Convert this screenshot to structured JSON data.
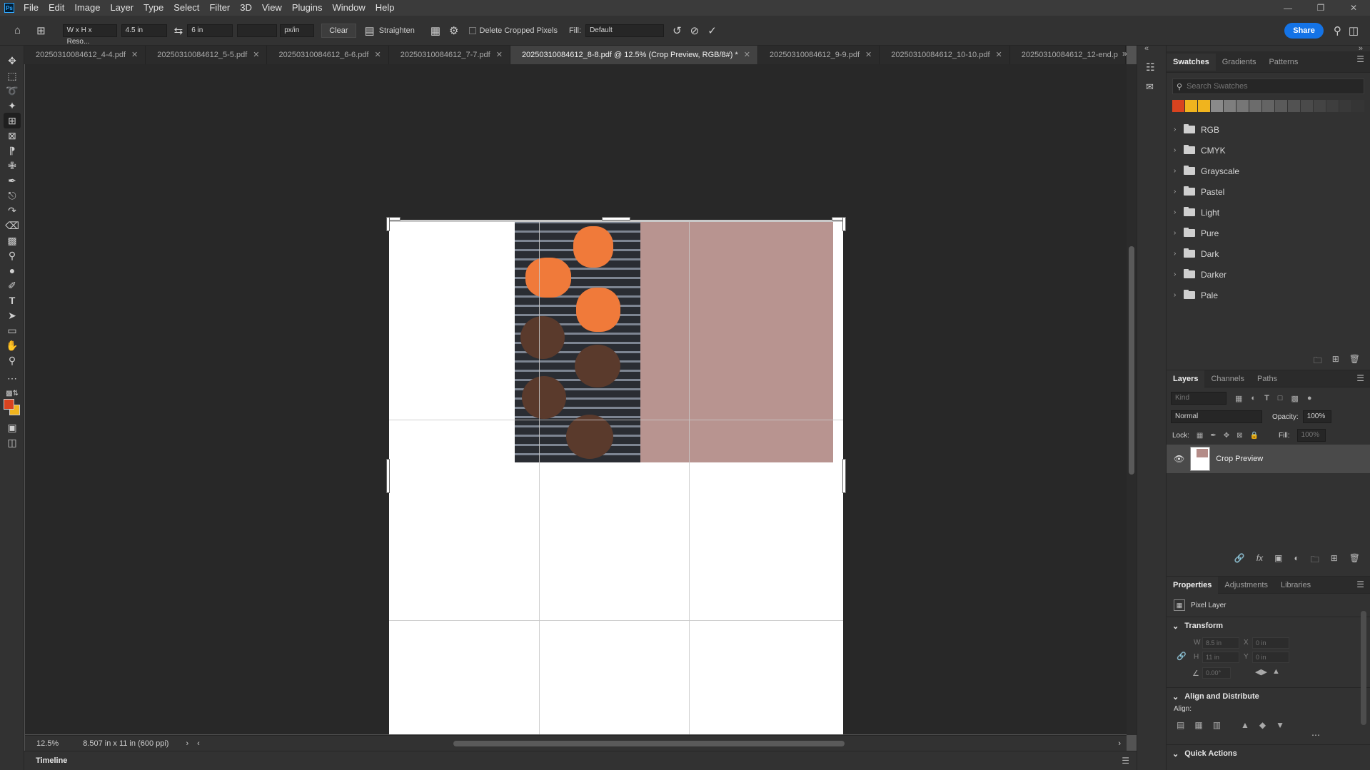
{
  "menubar": {
    "logo": "Ps",
    "items": [
      "File",
      "Edit",
      "Image",
      "Layer",
      "Type",
      "Select",
      "Filter",
      "3D",
      "View",
      "Plugins",
      "Window",
      "Help"
    ]
  },
  "options": {
    "ratio_preset": "W x H x Reso...",
    "width": "4.5 in",
    "height": "6 in",
    "resolution": "",
    "res_unit": "px/in",
    "clear": "Clear",
    "straighten": "Straighten",
    "delete_cropped": "Delete Cropped Pixels",
    "fill_label": "Fill:",
    "fill_value": "Default",
    "share": "Share"
  },
  "tabs": [
    {
      "label": "20250310084612_4-4.pdf",
      "active": false
    },
    {
      "label": "20250310084612_5-5.pdf",
      "active": false
    },
    {
      "label": "20250310084612_6-6.pdf",
      "active": false
    },
    {
      "label": "20250310084612_7-7.pdf",
      "active": false
    },
    {
      "label": "20250310084612_8-8.pdf @ 12.5% (Crop Preview, RGB/8#) *",
      "active": true
    },
    {
      "label": "20250310084612_9-9.pdf",
      "active": false
    },
    {
      "label": "20250310084612_10-10.pdf",
      "active": false
    },
    {
      "label": "20250310084612_12-end.p",
      "active": false
    }
  ],
  "status": {
    "zoom": "12.5%",
    "doc_info": "8.507 in x 11 in (600 ppi)"
  },
  "timeline": "Timeline",
  "swatches": {
    "tabs": [
      "Swatches",
      "Gradients",
      "Patterns"
    ],
    "search_placeholder": "Search Swatches",
    "recent_colors": [
      "#d9431f",
      "#f0b41e",
      "#f0b41e",
      "#8a8a8a",
      "#7e7e7e",
      "#767676",
      "#6c6c6c",
      "#646464",
      "#5a5a5a",
      "#525252",
      "#4a4a4a",
      "#444444",
      "#3e3e3e",
      "#393939",
      "#353535"
    ],
    "groups": [
      "RGB",
      "CMYK",
      "Grayscale",
      "Pastel",
      "Light",
      "Pure",
      "Dark",
      "Darker",
      "Pale"
    ]
  },
  "layers": {
    "tabs": [
      "Layers",
      "Channels",
      "Paths"
    ],
    "kind_placeholder": "Kind",
    "blend_mode": "Normal",
    "opacity_label": "Opacity:",
    "opacity": "100%",
    "lock_label": "Lock:",
    "fill_label": "Fill:",
    "fill": "100%",
    "layer_name": "Crop Preview"
  },
  "properties": {
    "tabs": [
      "Properties",
      "Adjustments",
      "Libraries"
    ],
    "type": "Pixel Layer",
    "transform_title": "Transform",
    "w_label": "W",
    "w": "8.5 in",
    "x_label": "X",
    "x": "0 in",
    "h_label": "H",
    "h": "11 in",
    "y_label": "Y",
    "y": "0 in",
    "angle": "0.00°",
    "align_title": "Align and Distribute",
    "align_label": "Align:",
    "quick_actions": "Quick Actions"
  },
  "colors": {
    "foreground": "#d9431f",
    "background": "#f0b41e",
    "accent": "#1473e6"
  }
}
